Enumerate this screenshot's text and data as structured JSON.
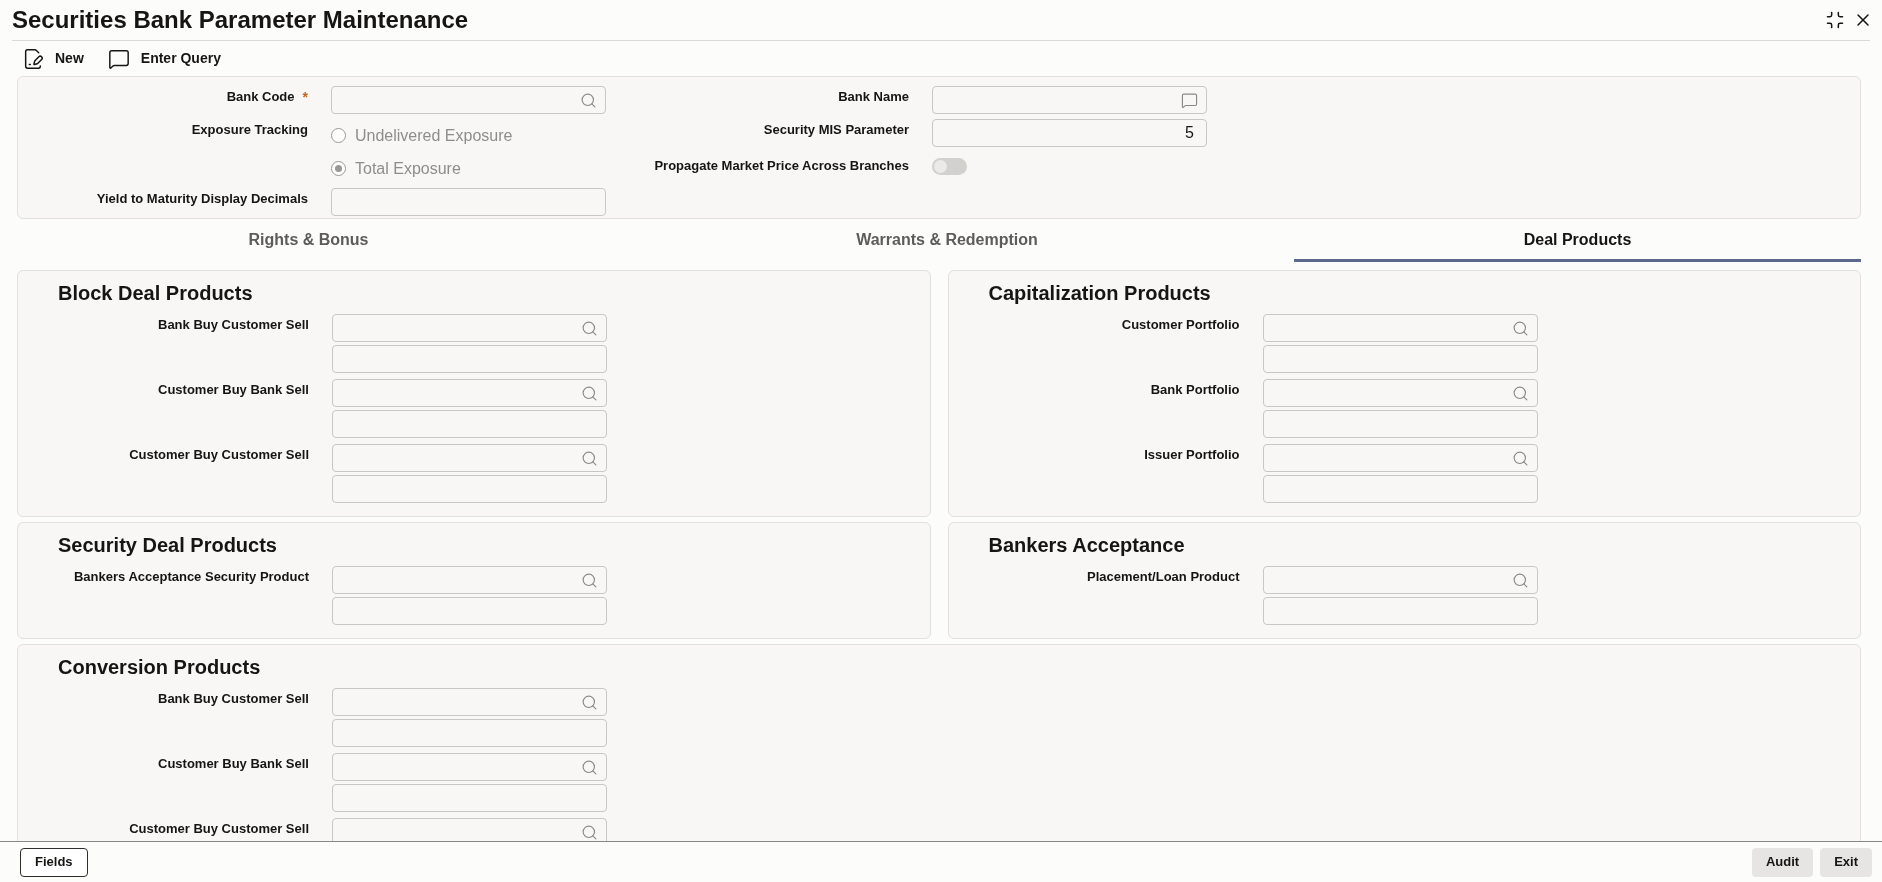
{
  "window": {
    "title": "Securities Bank Parameter Maintenance"
  },
  "toolbar": [
    {
      "kind": "new",
      "label": "New"
    },
    {
      "kind": "query",
      "label": "Enter Query"
    }
  ],
  "main_form": {
    "bank_code": {
      "label": "Bank Code",
      "required_mark": "*"
    },
    "exposure_tracking": {
      "label": "Exposure Tracking",
      "disabled": true,
      "options": [
        {
          "label": "Undelivered Exposure",
          "selected": false
        },
        {
          "label": "Total Exposure",
          "selected": true
        }
      ]
    },
    "yield_decimals": {
      "label": "Yield to Maturity Display Decimals"
    },
    "bank_name": {
      "label": "Bank Name"
    },
    "security_mis_parameter": {
      "label": "Security MIS Parameter",
      "value": "5"
    },
    "propagate_market_price": {
      "label": "Propagate Market Price Across Branches",
      "on": false
    }
  },
  "tabs": [
    {
      "label": "Rights & Bonus",
      "selected": false
    },
    {
      "label": "Warrants & Redemption",
      "selected": false
    },
    {
      "label": "Deal Products",
      "selected": true
    }
  ],
  "section_rows": [
    [
      {
        "title": "Block Deal Products",
        "fields": [
          {
            "label": "Bank Buy Customer Sell"
          },
          {
            "label": "Customer Buy Bank Sell"
          },
          {
            "label": "Customer Buy Customer Sell"
          }
        ]
      },
      {
        "title": "Capitalization Products",
        "fields": [
          {
            "label": "Customer Portfolio"
          },
          {
            "label": "Bank Portfolio"
          },
          {
            "label": "Issuer Portfolio"
          }
        ]
      }
    ],
    [
      {
        "title": "Security Deal Products",
        "fields": [
          {
            "label": "Bankers Acceptance Security Product"
          }
        ]
      },
      {
        "title": "Bankers Acceptance",
        "fields": [
          {
            "label": "Placement/Loan Product"
          }
        ]
      }
    ],
    [
      {
        "title": "Conversion Products",
        "fields": [
          {
            "label": "Bank Buy Customer Sell"
          },
          {
            "label": "Customer Buy Bank Sell"
          },
          {
            "label": "Customer Buy Customer Sell"
          }
        ]
      }
    ]
  ],
  "footer": {
    "left_buttons": [
      "Fields"
    ],
    "right_buttons": [
      "Audit",
      "Exit"
    ]
  }
}
